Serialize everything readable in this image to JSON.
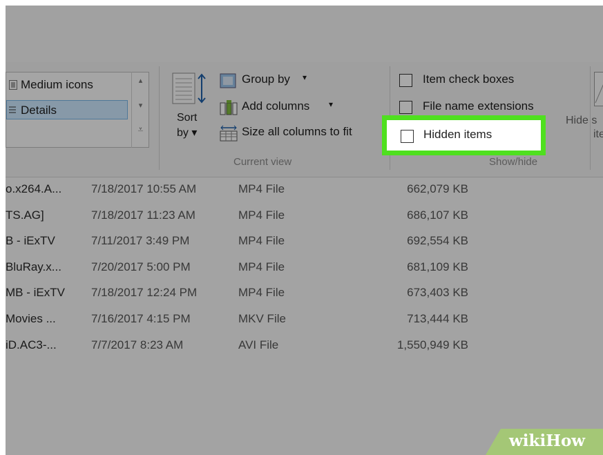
{
  "ribbon": {
    "layout": {
      "items": [
        {
          "label": "Medium icons",
          "icon": "medium-icons-icon"
        },
        {
          "label": "Details",
          "icon": "details-icon"
        }
      ],
      "selected": "Details"
    },
    "current_view": {
      "sort_label_line1": "Sort",
      "sort_label_line2": "by",
      "group_by": "Group by",
      "add_columns": "Add columns",
      "size_all_columns": "Size all columns to fit",
      "group_label": "Current view"
    },
    "show_hide": {
      "item_check_boxes": "Item check boxes",
      "file_name_extensions": "File name extensions",
      "hidden_items": "Hidden items",
      "hidden_items_checked": false,
      "hide_selected_line1": "Hide s",
      "hide_selected_line2": "ite",
      "group_label": "Show/hide"
    },
    "highlight_color": "#4fe01f"
  },
  "files": [
    {
      "name": "o.x264.A...",
      "date": "7/18/2017 10:55 AM",
      "type": "MP4 File",
      "size": "662,079 KB"
    },
    {
      "name": "TS.AG]",
      "date": "7/18/2017 11:23 AM",
      "type": "MP4 File",
      "size": "686,107 KB"
    },
    {
      "name": "B - iExTV",
      "date": "7/11/2017 3:49 PM",
      "type": "MP4 File",
      "size": "692,554 KB"
    },
    {
      "name": "BluRay.x...",
      "date": "7/20/2017 5:00 PM",
      "type": "MP4 File",
      "size": "681,109 KB"
    },
    {
      "name": "MB - iExTV",
      "date": "7/18/2017 12:24 PM",
      "type": "MP4 File",
      "size": "673,403 KB"
    },
    {
      "name": "Movies ...",
      "date": "7/16/2017 4:15 PM",
      "type": "MKV File",
      "size": "713,444 KB"
    },
    {
      "name": "iD.AC3-...",
      "date": "7/7/2017 8:23 AM",
      "type": "AVI File",
      "size": "1,550,949 KB"
    }
  ],
  "watermark": {
    "part1": "wiki",
    "part2": "How"
  }
}
